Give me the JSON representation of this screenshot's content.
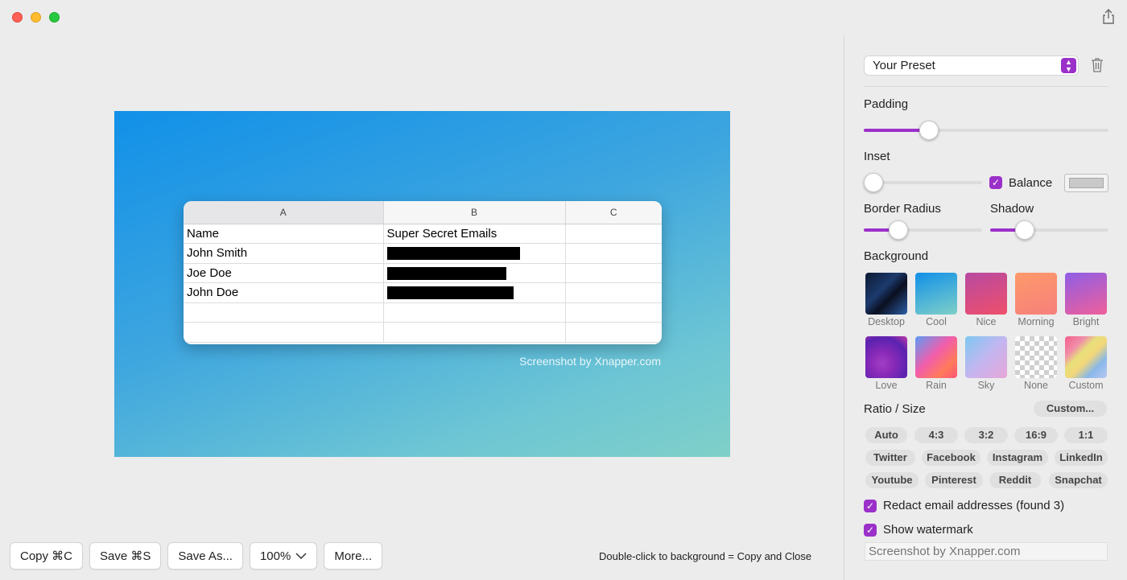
{
  "window": {
    "controls": [
      "close",
      "minimize",
      "zoom"
    ],
    "share_icon": "share-icon"
  },
  "canvas": {
    "background_colors": [
      "#1190e8",
      "#7fd0c8"
    ],
    "watermark": "Screenshot by Xnapper.com",
    "sheet": {
      "columns": [
        "A",
        "B",
        "C"
      ],
      "rows": [
        [
          "Name",
          "Super Secret Emails",
          ""
        ],
        [
          "John Smith",
          "[redacted]",
          ""
        ],
        [
          "Joe Doe",
          "[redacted]",
          ""
        ],
        [
          "John Doe",
          "[redacted]",
          ""
        ],
        [
          "",
          "",
          ""
        ],
        [
          "",
          "",
          ""
        ]
      ]
    }
  },
  "toolbar": {
    "copy": "Copy ⌘C",
    "save": "Save ⌘S",
    "save_as": "Save As...",
    "zoom": "100%",
    "more": "More...",
    "hint": "Double-click to background = Copy and Close"
  },
  "panel": {
    "preset": "Your Preset",
    "padding_label": "Padding",
    "padding_value": 0.27,
    "inset_label": "Inset",
    "inset_value": 0.0,
    "balance_label": "Balance",
    "balance_checked": true,
    "border_radius_label": "Border Radius",
    "border_radius_value": 0.29,
    "shadow_label": "Shadow",
    "shadow_value": 0.29,
    "background_label": "Background",
    "backgrounds": [
      {
        "name": "Desktop"
      },
      {
        "name": "Cool"
      },
      {
        "name": "Nice"
      },
      {
        "name": "Morning"
      },
      {
        "name": "Bright"
      },
      {
        "name": "Love"
      },
      {
        "name": "Rain"
      },
      {
        "name": "Sky"
      },
      {
        "name": "None"
      },
      {
        "name": "Custom"
      }
    ],
    "selected_background": "Cool",
    "ratio_label": "Ratio / Size",
    "custom_button": "Custom...",
    "ratios_row1": [
      "Auto",
      "4:3",
      "3:2",
      "16:9",
      "1:1"
    ],
    "ratios_row2": [
      "Twitter",
      "Facebook",
      "Instagram",
      "LinkedIn"
    ],
    "ratios_row3": [
      "Youtube",
      "Pinterest",
      "Reddit",
      "Snapchat"
    ],
    "redact_label": "Redact email addresses (found 3)",
    "redact_checked": true,
    "watermark_label": "Show watermark",
    "watermark_checked": true,
    "watermark_placeholder": "Screenshot by Xnapper.com",
    "accent_color": "#9b30c9"
  }
}
